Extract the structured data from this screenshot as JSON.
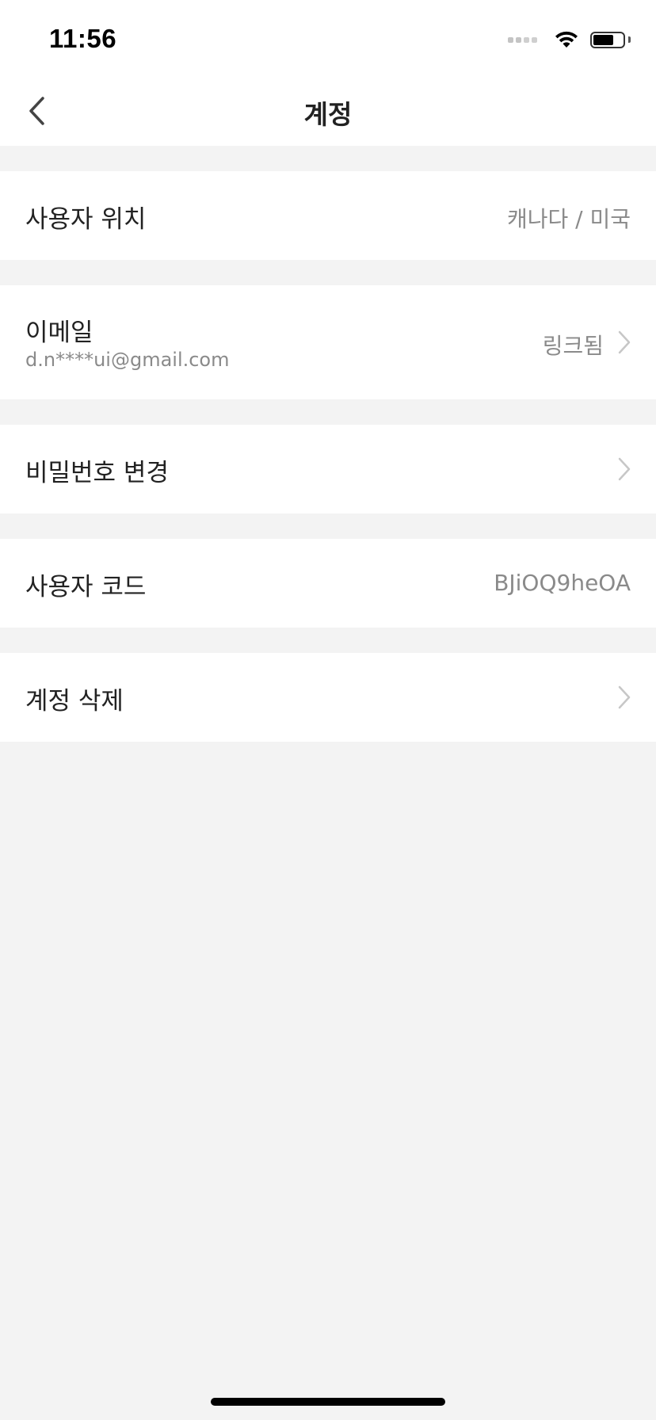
{
  "status_bar": {
    "time": "11:56",
    "battery_level": 0.7
  },
  "nav": {
    "title": "계정",
    "back_icon": "chevron-left-icon"
  },
  "rows": {
    "location": {
      "label": "사용자 위치",
      "value": "캐나다 / 미국"
    },
    "email": {
      "label": "이메일",
      "sub": "d.n****ui@gmail.com",
      "value": "링크됨"
    },
    "password": {
      "label": "비밀번호 변경"
    },
    "user_code": {
      "label": "사용자 코드",
      "value": "BJiOQ9heOA"
    },
    "delete": {
      "label": "계정 삭제"
    }
  },
  "colors": {
    "background": "#f3f3f3",
    "surface": "#ffffff",
    "text_primary": "#222222",
    "text_secondary": "#8a8a8a",
    "chevron": "#c7c7c7"
  }
}
